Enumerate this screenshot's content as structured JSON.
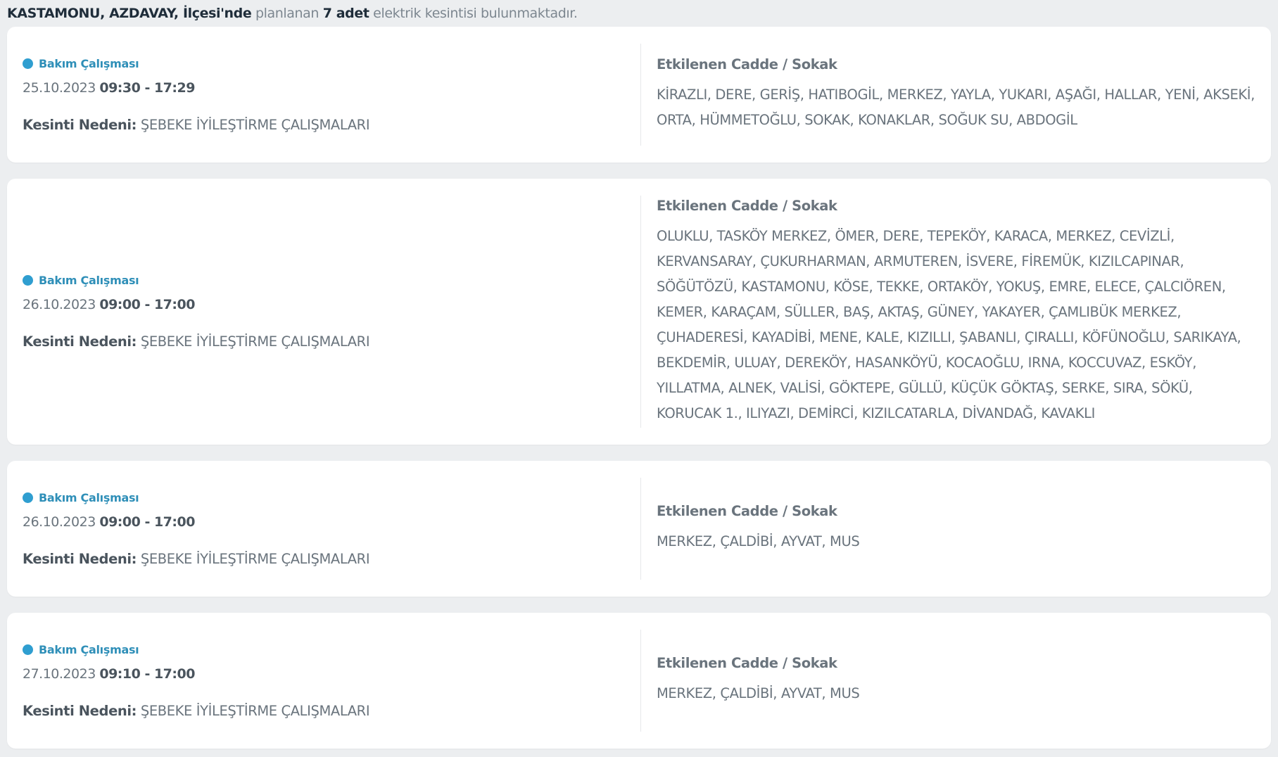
{
  "summary": {
    "location": "KASTAMONU, AZDAVAY, İlçesi'nde",
    "pre_count": "planlanan",
    "count": "7 adet",
    "post_count": "elektrik kesintisi bulunmaktadır."
  },
  "colors": {
    "accent": "#2f9ed0",
    "background": "#eceef0",
    "card": "#ffffff"
  },
  "outages": [
    {
      "type_icon": "status-dot-icon",
      "type": "Bakım Çalışması",
      "date": "25.10.2023",
      "time": "09:30 - 17:29",
      "reason_label": "Kesinti Nedeni:",
      "reason": "ŞEBEKE İYİLEŞTİRME ÇALIŞMALARI",
      "streets_title": "Etkilenen Cadde / Sokak",
      "streets": "KİRAZLI, DERE, GERİŞ, HATIBOGİL, MERKEZ, YAYLA, YUKARI, AŞAĞI, HALLAR, YENİ, AKSEKİ, ORTA, HÜMMETOĞLU, SOKAK, KONAKLAR, SOĞUK SU, ABDOGİL"
    },
    {
      "type_icon": "status-dot-icon",
      "type": "Bakım Çalışması",
      "date": "26.10.2023",
      "time": "09:00 - 17:00",
      "reason_label": "Kesinti Nedeni:",
      "reason": "ŞEBEKE İYİLEŞTİRME ÇALIŞMALARI",
      "streets_title": "Etkilenen Cadde / Sokak",
      "streets": "OLUKLU, TASKÖY MERKEZ, ÖMER, DERE, TEPEKÖY, KARACA, MERKEZ, CEVİZLİ, KERVANSARAY, ÇUKURHARMAN, ARMUTEREN, İSVERE, FİREMÜK, KIZILCAPINAR, SÖĞÜTÖZÜ, KASTAMONU, KÖSE, TEKKE, ORTAKÖY, YOKUŞ, EMRE, ELECE, ÇALCIÖREN, KEMER, KARAÇAM, SÜLLER, BAŞ, AKTAŞ, GÜNEY, YAKAYER, ÇAMLIBÜK MERKEZ, ÇUHADERESİ, KAYADİBİ, MENE, KALE, KIZILLI, ŞABANLI, ÇIRALLI, KÖFÜNOĞLU, SARIKAYA, BEKDEMİR, ULUAY, DEREKÖY, HASANKÖYÜ, KOCAOĞLU, IRNA, KOCCUVAZ, ESKÖY, YILLATMA, ALNEK, VALİSİ, GÖKTEPE, GÜLLÜ, KÜÇÜK GÖKTAŞ, SERKE, SIRA, SÖKÜ, KORUCAK 1., ILIYAZI, DEMİRCİ, KIZILCATARLA, DİVANDAĞ, KAVAKLI"
    },
    {
      "type_icon": "status-dot-icon",
      "type": "Bakım Çalışması",
      "date": "26.10.2023",
      "time": "09:00 - 17:00",
      "reason_label": "Kesinti Nedeni:",
      "reason": "ŞEBEKE İYİLEŞTİRME ÇALIŞMALARI",
      "streets_title": "Etkilenen Cadde / Sokak",
      "streets": "MERKEZ, ÇALDİBİ, AYVAT, MUS"
    },
    {
      "type_icon": "status-dot-icon",
      "type": "Bakım Çalışması",
      "date": "27.10.2023",
      "time": "09:10 - 17:00",
      "reason_label": "Kesinti Nedeni:",
      "reason": "ŞEBEKE İYİLEŞTİRME ÇALIŞMALARI",
      "streets_title": "Etkilenen Cadde / Sokak",
      "streets": "MERKEZ, ÇALDİBİ, AYVAT, MUS"
    }
  ]
}
